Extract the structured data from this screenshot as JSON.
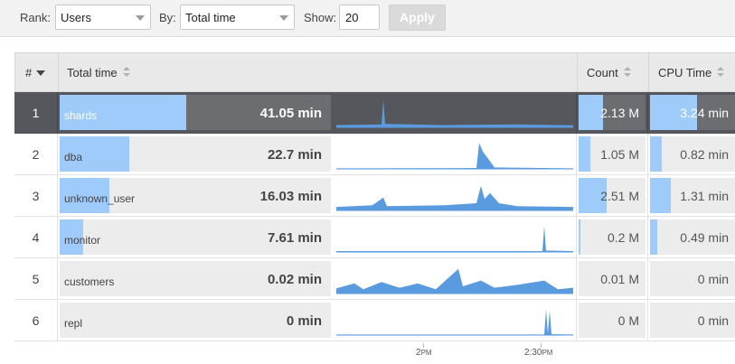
{
  "toolbar": {
    "rank_label": "Rank:",
    "rank_value": "Users",
    "by_label": "By:",
    "by_value": "Total time",
    "show_label": "Show:",
    "show_value": "20",
    "apply_label": "Apply"
  },
  "table": {
    "headers": {
      "num": "#",
      "total_time": "Total time",
      "count": "Count",
      "cpu_time": "CPU Time"
    },
    "selected_row": 1,
    "rows": [
      {
        "num": "1",
        "name": "shards",
        "total": "41.05 min",
        "total_frac": 1.0,
        "count": "2.13 M",
        "count_frac": 0.36,
        "cpu": "3.24 min",
        "cpu_frac": 0.55
      },
      {
        "num": "2",
        "name": "dba",
        "total": "22.7 min",
        "total_frac": 0.55,
        "count": "1.05 M",
        "count_frac": 0.18,
        "cpu": "0.82 min",
        "cpu_frac": 0.14
      },
      {
        "num": "3",
        "name": "unknown_user",
        "total": "16.03 min",
        "total_frac": 0.39,
        "count": "2.51 M",
        "count_frac": 0.42,
        "cpu": "1.31 min",
        "cpu_frac": 0.24
      },
      {
        "num": "4",
        "name": "monitor",
        "total": "7.61 min",
        "total_frac": 0.185,
        "count": "0.2 M",
        "count_frac": 0.03,
        "cpu": "0.49 min",
        "cpu_frac": 0.09
      },
      {
        "num": "5",
        "name": "customers",
        "total": "0.02 min",
        "total_frac": 0.0,
        "count": "0.01 M",
        "count_frac": 0.0,
        "cpu": "0 min",
        "cpu_frac": 0.0
      },
      {
        "num": "6",
        "name": "repl",
        "total": "0 min",
        "total_frac": 0.0,
        "count": "0 M",
        "count_frac": 0.0,
        "cpu": "0 min",
        "cpu_frac": 0.0
      }
    ],
    "time_ticks": [
      {
        "label": "2",
        "suffix": "PM"
      },
      {
        "label": "2:30",
        "suffix": "PM"
      }
    ]
  },
  "colors": {
    "bar": "#9fcbfa",
    "spark": "#5a9be0",
    "selected_row": "#56575c"
  }
}
